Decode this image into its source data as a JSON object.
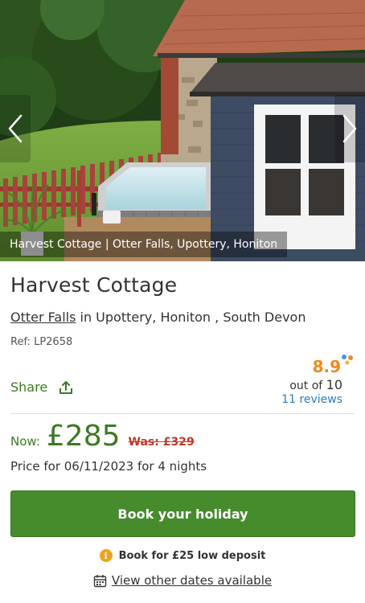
{
  "gallery": {
    "caption": "Harvest Cottage | Otter Falls, Upottery, Honiton",
    "prev_icon": "chevron-left-icon",
    "next_icon": "chevron-right-icon"
  },
  "property": {
    "title": "Harvest Cottage",
    "location_link": "Otter Falls",
    "location_rest": " in Upottery, Honiton , South Devon",
    "ref": "Ref: LP2658"
  },
  "share": {
    "label": "Share",
    "icon": "share-icon"
  },
  "rating": {
    "score": "8.9",
    "out_of": "out of",
    "max": "10",
    "reviews": "11 reviews"
  },
  "price": {
    "now_label": "Now:",
    "now": "£285",
    "was": "Was: £329",
    "note": "Price for 06/11/2023 for 4 nights"
  },
  "actions": {
    "book_label": "Book your holiday",
    "deposit_text": "Book for £25 low deposit",
    "dates_label": "View other dates available"
  },
  "colors": {
    "brand_green": "#468b2c",
    "rating_orange": "#f08a1c",
    "link_blue": "#2b7bbf",
    "was_red": "#c0392b"
  }
}
